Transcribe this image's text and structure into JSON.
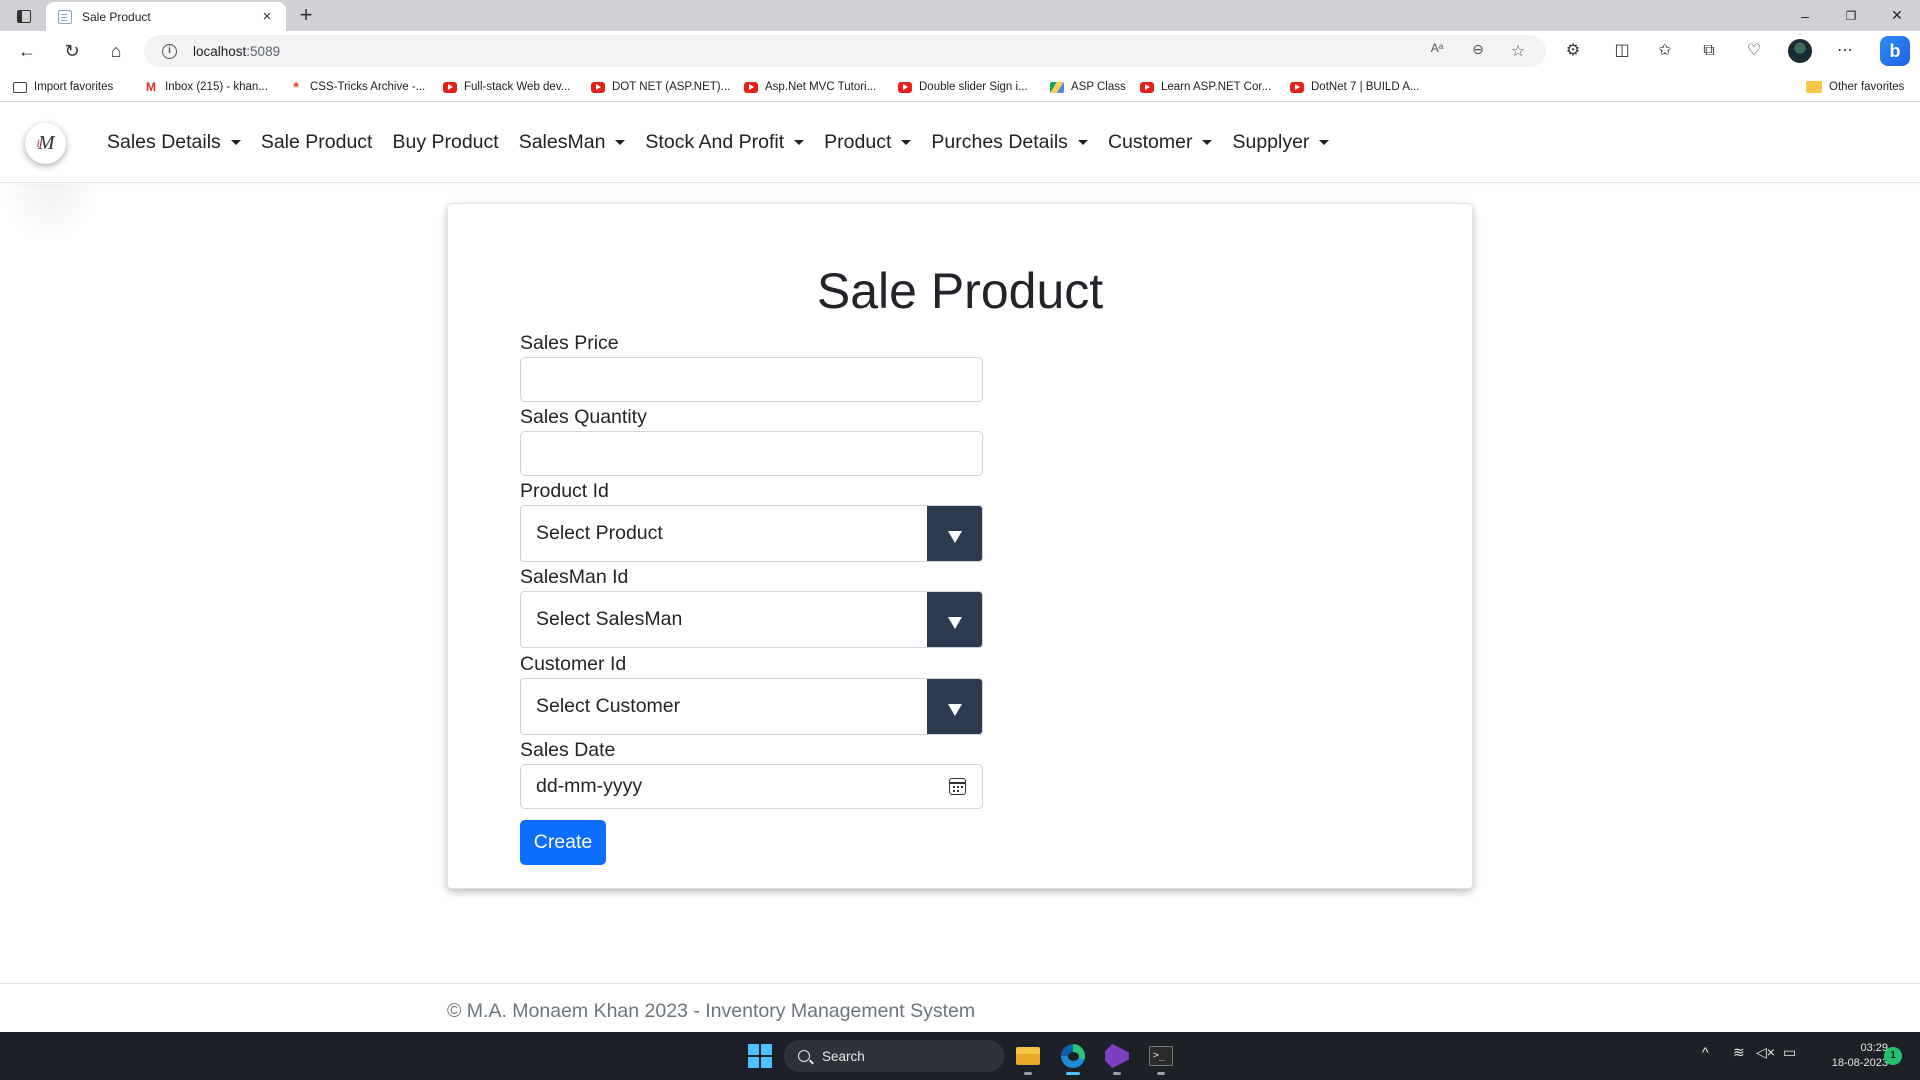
{
  "browser": {
    "tab_title": "Sale Product",
    "tab_close_icon": "×",
    "new_tab_icon": "+",
    "url_host": "localhost",
    "url_port": ":5089",
    "window_controls": [
      "–",
      "❐",
      "✕"
    ],
    "favorites": [
      {
        "label": "Import favorites",
        "icon": "import-icon"
      },
      {
        "label": "Inbox (215) - khan...",
        "icon": "gmail-icon"
      },
      {
        "label": "CSS-Tricks Archive -...",
        "icon": "css-tricks-icon"
      },
      {
        "label": "Full-stack Web dev...",
        "icon": "youtube-icon"
      },
      {
        "label": "DOT NET (ASP.NET)...",
        "icon": "youtube-icon"
      },
      {
        "label": "Asp.Net MVC Tutori...",
        "icon": "youtube-icon"
      },
      {
        "label": "Double slider Sign i...",
        "icon": "youtube-icon"
      },
      {
        "label": "ASP Class",
        "icon": "google-drive-icon"
      },
      {
        "label": "Learn ASP.NET Cor...",
        "icon": "youtube-icon"
      },
      {
        "label": "DotNet 7 | BUILD A...",
        "icon": "youtube-icon"
      }
    ],
    "other_favorites": "Other favorites"
  },
  "navbar": {
    "logo_text": "M",
    "logo_prefix": "i",
    "items": [
      {
        "label": "Sales Details",
        "dropdown": true
      },
      {
        "label": "Sale Product",
        "dropdown": false
      },
      {
        "label": "Buy Product",
        "dropdown": false
      },
      {
        "label": "SalesMan",
        "dropdown": true
      },
      {
        "label": "Stock And Profit",
        "dropdown": true
      },
      {
        "label": "Product",
        "dropdown": true
      },
      {
        "label": "Purches Details",
        "dropdown": true
      },
      {
        "label": "Customer",
        "dropdown": true
      },
      {
        "label": "Supplyer",
        "dropdown": true
      }
    ]
  },
  "form": {
    "title": "Sale Product",
    "sales_price_label": "Sales Price",
    "sales_price_value": "",
    "sales_quantity_label": "Sales Quantity",
    "sales_quantity_value": "",
    "product_id_label": "Product Id",
    "product_id_selected": "Select Product",
    "salesman_id_label": "SalesMan Id",
    "salesman_id_selected": "Select SalesMan",
    "customer_id_label": "Customer Id",
    "customer_id_selected": "Select Customer",
    "sales_date_label": "Sales Date",
    "sales_date_placeholder": "dd-mm-yyyy",
    "create_label": "Create"
  },
  "footer": {
    "text": "© M.A. Monaem Khan 2023 - Inventory Management System"
  },
  "taskbar": {
    "search_label": "Search",
    "time": "03:29",
    "date": "18-08-2023",
    "notification_count": "1"
  },
  "colors": {
    "primary_button": "#0d6efd",
    "select_arrow_bg": "#2b3a4f",
    "taskbar_bg": "#1d2127"
  }
}
